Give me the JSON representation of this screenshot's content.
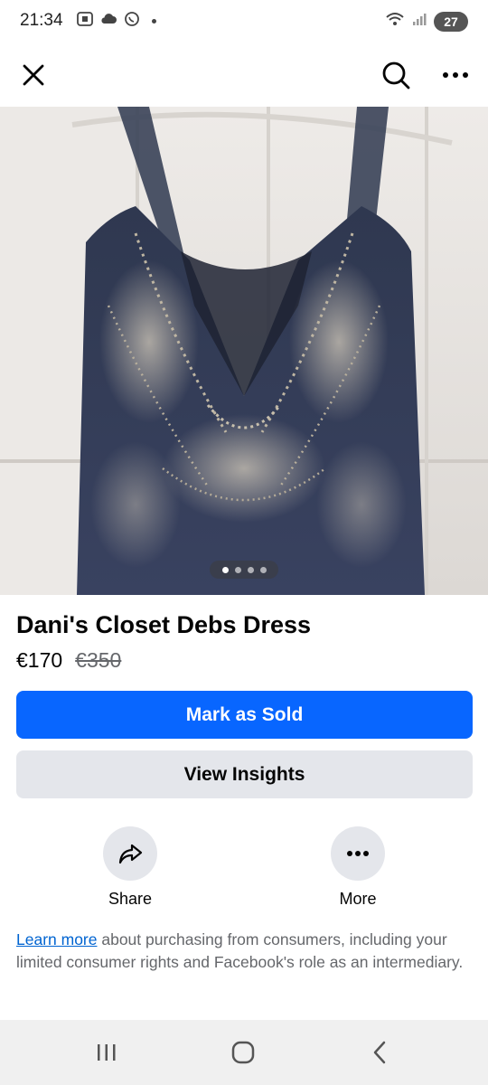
{
  "status_bar": {
    "time": "21:34",
    "battery": "27",
    "left_icons": [
      "screenshot-icon",
      "cloud-icon",
      "whatsapp-icon"
    ],
    "right_icons": [
      "wifi-icon",
      "signal-icon"
    ]
  },
  "nav": {
    "icons": [
      "close-icon",
      "search-icon",
      "more-icon"
    ]
  },
  "listing": {
    "title": "Dani's Closet Debs Dress",
    "price": "€170",
    "original_price": "€350",
    "photo_count": 4,
    "active_photo": 1
  },
  "buttons": {
    "mark_sold": "Mark as Sold",
    "view_insights": "View Insights"
  },
  "actions": {
    "share": "Share",
    "more": "More"
  },
  "disclaimer": {
    "link": "Learn more",
    "text": " about purchasing from consumers, including your limited consumer rights and Facebook's role as an intermediary."
  },
  "colors": {
    "primary": "#0866ff",
    "secondary": "#e4e6eb",
    "link": "#0064d1"
  }
}
